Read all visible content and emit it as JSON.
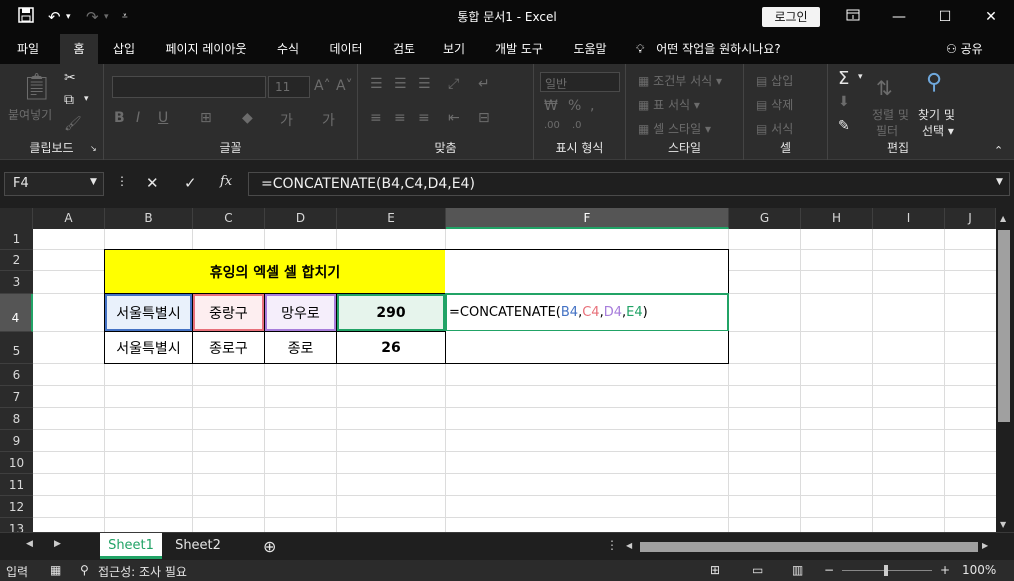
{
  "window": {
    "title": "통합 문서1  -  Excel",
    "login_label": "로그인"
  },
  "ribbon_tabs": [
    "파일",
    "홈",
    "삽입",
    "페이지 레이아웃",
    "수식",
    "데이터",
    "검토",
    "보기",
    "개발 도구",
    "도움말"
  ],
  "tell_me": "어떤 작업을 원하시나요?",
  "share_label": "공유",
  "ribbon": {
    "clipboard": {
      "paste": "붙여넣기",
      "label": "클립보드"
    },
    "font": {
      "size": "11",
      "label": "글꼴"
    },
    "alignment": {
      "label": "맞춤"
    },
    "number": {
      "format": "일반",
      "label": "표시 형식"
    },
    "styles": {
      "conditional": "조건부 서식",
      "as_table": "표 서식",
      "cell_styles": "셀 스타일",
      "label": "스타일"
    },
    "cells": {
      "insert": "삽입",
      "delete": "삭제",
      "format": "서식",
      "label": "셀"
    },
    "editing": {
      "sort": "정렬 및",
      "filter": "필터",
      "find": "찾기 및",
      "select": "선택",
      "label": "편집"
    }
  },
  "formula_bar": {
    "name_box": "F4",
    "formula": "=CONCATENATE(B4,C4,D4,E4)"
  },
  "columns": [
    "A",
    "B",
    "C",
    "D",
    "E",
    "F",
    "G",
    "H",
    "I",
    "J"
  ],
  "rows": [
    "1",
    "2",
    "3",
    "4",
    "5",
    "6",
    "7",
    "8",
    "9",
    "10",
    "11",
    "12",
    "13"
  ],
  "sheet": {
    "title_cell": "휴잉의 엑셀 셀 합치기",
    "row4": [
      "서울특별시",
      "중랑구",
      "망우로",
      "290"
    ],
    "row5": [
      "서울특별시",
      "종로구",
      "종로",
      "26"
    ],
    "f4_formula": {
      "prefix": "=CONCATENATE(",
      "b": "B4",
      "c": "C4",
      "d": "D4",
      "e": "E4",
      "sep": ",",
      "suffix": ")"
    }
  },
  "sheets": [
    "Sheet1",
    "Sheet2"
  ],
  "status": {
    "mode": "입력",
    "accessibility": "접근성: 조사 필요",
    "zoom": "100%"
  },
  "colors": {
    "accent_green": "#21a366",
    "title_fill": "#ffff00",
    "ref_blue": "#4472c4",
    "ref_red": "#e8707a",
    "ref_purple": "#a77ddb",
    "ref_green": "#21a366"
  }
}
